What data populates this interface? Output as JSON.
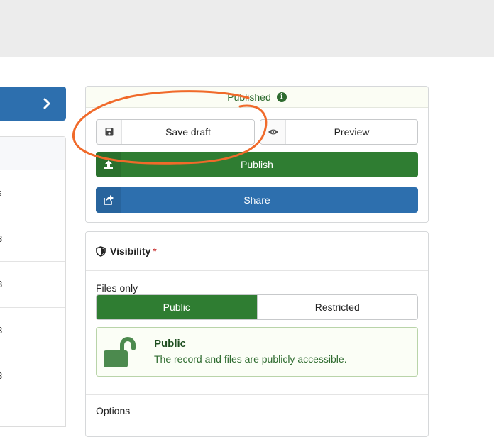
{
  "left_rows": [
    "s",
    "3",
    "3",
    "3",
    "3"
  ],
  "status": {
    "label": "Published",
    "info_icon": "info-circle-icon"
  },
  "buttons": {
    "save_draft": "Save draft",
    "preview": "Preview",
    "publish": "Publish",
    "share": "Share"
  },
  "visibility": {
    "title": "Visibility",
    "required_mark": "*",
    "files_label": "Files only",
    "options": [
      "Public",
      "Restricted"
    ],
    "selected": "Public",
    "message_title": "Public",
    "message_desc": "The record and files are publicly accessible.",
    "options_label": "Options"
  },
  "colors": {
    "publish_green": "#2f7d32",
    "share_blue": "#2d6fae",
    "annotation_orange": "#f06a2a"
  }
}
